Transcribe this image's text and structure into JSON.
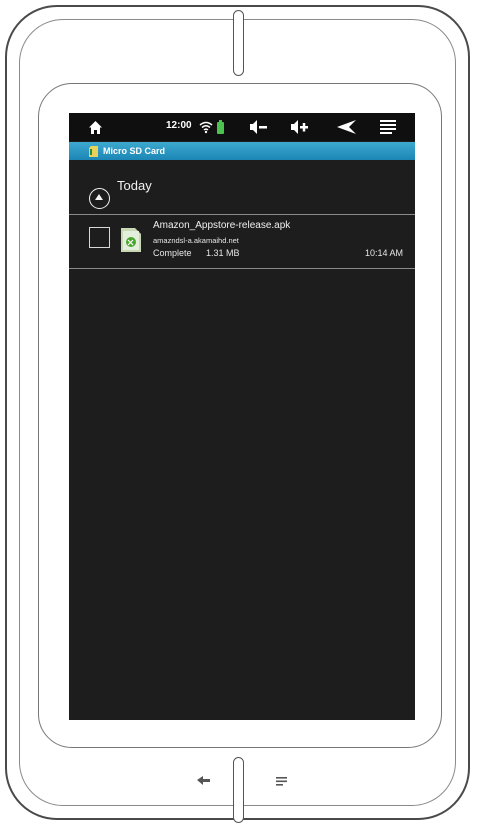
{
  "status_bar": {
    "time": "12:00",
    "icons": [
      "home-icon",
      "wifi-icon",
      "battery-icon",
      "volume-down-icon",
      "volume-up-icon",
      "back-icon",
      "menu-icon"
    ]
  },
  "title_bar": {
    "title": "Micro SD Card",
    "icon": "sd-card-icon"
  },
  "downloads": {
    "group_label": "Today",
    "items": [
      {
        "name": "Amazon_Appstore-release.apk",
        "host": "amazndsl-a.akamaihd.net",
        "status": "Complete",
        "size": "1.31 MB",
        "time": "10:14 AM",
        "icon": "apk-file-icon"
      }
    ]
  },
  "hardware_buttons": {
    "icons": [
      "hardware-back-icon",
      "hardware-menu-icon"
    ]
  },
  "colors": {
    "screen_bg": "#1e1d1d",
    "status_bar_bg": "#0f0f0f",
    "title_bar": "#2a98c4",
    "battery": "#4ec24e"
  }
}
